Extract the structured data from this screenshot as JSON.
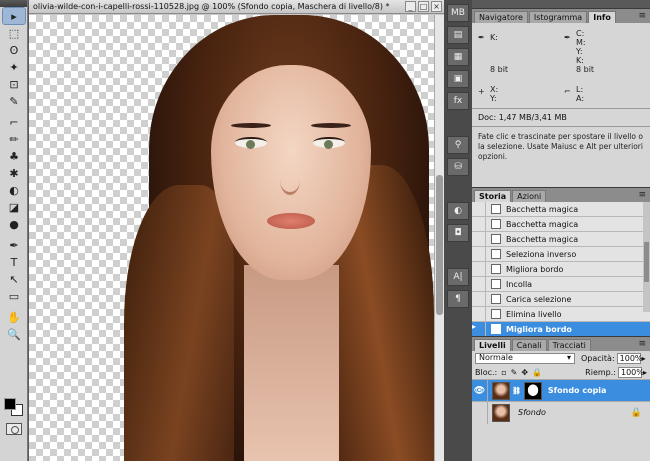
{
  "document": {
    "title": "olivia-wilde-con-i-capelli-rossi-110528.jpg @ 100% (Sfondo copia, Maschera di livello/8) *",
    "controls": [
      "_",
      "□",
      "×"
    ]
  },
  "tools": [
    "▸",
    "⬚",
    "ʘ",
    "✦",
    "⊡",
    "✎",
    "⌐",
    "✏",
    "♣",
    "✱",
    "◐",
    "◪",
    "●",
    "✒",
    "T",
    "↖",
    "▭",
    "✋",
    "🔍"
  ],
  "dock": [
    "MB",
    "",
    "",
    "",
    "fx",
    "",
    "",
    "",
    "",
    "◐",
    "◘",
    "",
    "A|",
    "¶"
  ],
  "info_panel": {
    "tabs": [
      "Navigatore",
      "Istogramma",
      "Info"
    ],
    "active_tab": "Info",
    "k_label": "K:",
    "bit_left": "8 bit",
    "cmyk": "C:\nM:\nY:\nK:",
    "bit_right": "8 bit",
    "xy": "X:\nY:",
    "lh": "L:\nA:",
    "doc": "Doc: 1,47 MB/3,41 MB",
    "hint": "Fate clic e trascinate per spostare il livello o la selezione. Usate Maiusc e Alt per ulteriori opzioni."
  },
  "history_panel": {
    "tabs": [
      "Storia",
      "Azioni"
    ],
    "active_tab": "Storia",
    "items": [
      "Bacchetta magica",
      "Bacchetta magica",
      "Bacchetta magica",
      "Seleziona inverso",
      "Migliora bordo",
      "Incolla",
      "Carica selezione",
      "Elimina livello",
      "Migliora bordo"
    ],
    "selected_index": 8
  },
  "layers_panel": {
    "tabs": [
      "Livelli",
      "Canali",
      "Tracciati"
    ],
    "active_tab": "Livelli",
    "blend_mode": "Normale",
    "opacity_label": "Opacità:",
    "opacity_value": "100%",
    "lock_label": "Bloc.:",
    "fill_label": "Riemp.:",
    "fill_value": "100%",
    "layers": [
      {
        "name": "Sfondo copia",
        "visible": true,
        "selected": true,
        "has_mask": true
      },
      {
        "name": "Sfondo",
        "visible": false,
        "selected": false,
        "locked": true
      }
    ]
  },
  "colors": {
    "accent": "#3b8de0",
    "panel_bg": "#d6d6d6",
    "dock_bg": "#4a4a4a"
  }
}
